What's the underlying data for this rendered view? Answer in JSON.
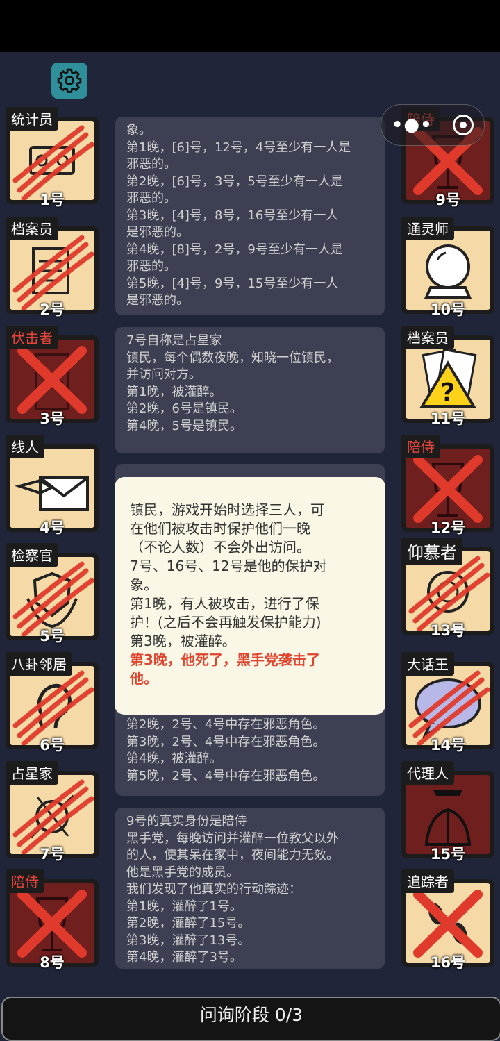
{
  "app": {
    "settings_icon": "gear-icon"
  },
  "capsule": {
    "more_icon": "more-dots-icon",
    "close_icon": "target-circle-icon"
  },
  "left_players": [
    {
      "role": "统计员",
      "number": "1号",
      "state": "scratched",
      "icon": "tally-sheet-icon"
    },
    {
      "role": "档案员",
      "number": "2号",
      "state": "scratched",
      "icon": "files-icon"
    },
    {
      "role": "伏击者",
      "number": "3号",
      "state": "dead",
      "icon": "door-icon"
    },
    {
      "role": "线人",
      "number": "4号",
      "state": "normal",
      "icon": "envelope-hand-icon"
    },
    {
      "role": "检察官",
      "number": "5号",
      "state": "scratched",
      "icon": "laurel-shield-icon"
    },
    {
      "role": "八卦邻居",
      "number": "6号",
      "state": "scratched",
      "icon": "ear-icon"
    },
    {
      "role": "占星家",
      "number": "7号",
      "state": "scratched",
      "icon": "astrolabe-icon"
    },
    {
      "role": "陪侍",
      "number": "8号",
      "state": "dead",
      "icon": "wine-glass-icon"
    }
  ],
  "right_players": [
    {
      "role": "陪侍",
      "number": "9号",
      "state": "dead",
      "icon": "wine-glass-icon"
    },
    {
      "role": "通灵师",
      "number": "10号",
      "state": "normal",
      "icon": "crystal-ball-icon"
    },
    {
      "role": "档案员",
      "number": "11号",
      "state": "normal",
      "icon": "warning-question-icon"
    },
    {
      "role": "陪侍",
      "number": "12号",
      "state": "dead",
      "icon": "wine-glass-icon"
    },
    {
      "role": "仰慕者",
      "number": "13号",
      "state": "scratched",
      "icon": "lion-emblem-icon"
    },
    {
      "role": "大话王",
      "number": "14号",
      "state": "scratched",
      "icon": "speech-bubble-icon"
    },
    {
      "role": "代理人",
      "number": "15号",
      "state": "normal-dark",
      "icon": "suited-agent-icon"
    },
    {
      "role": "追踪者",
      "number": "16号",
      "state": "dead-light",
      "icon": "footprints-icon"
    }
  ],
  "messages": [
    {
      "lines": [
        "象。",
        "第1晚，[6]号，12号，4号至少有一人是",
        "邪恶的。",
        "第2晚，[6]号，3号，5号至少有一人是",
        "邪恶的。",
        "第3晚，[4]号，8号，16号至少有一人",
        "是邪恶的。",
        "第4晚，[8]号，2号，9号至少有一人是",
        "邪恶的。",
        "第5晚，[4]号，9号，15号至少有一人",
        "是邪恶的。"
      ]
    },
    {
      "lines": [
        "7号自称是占星家",
        "镇民，每个偶数夜晚，知晓一位镇民，",
        "并访问对方。",
        "第1晚，被灌醉。",
        "第2晚，6号是镇民。",
        "第4晚，5号是镇民。"
      ]
    },
    {
      "lines": [
        "第2晚，2号、4号中存在邪恶角色。",
        "第3晚，2号、4号中存在邪恶角色。",
        "第4晚，被灌醉。",
        "第5晚，2号、4号中存在邪恶角色。"
      ]
    },
    {
      "lines": [
        "9号的真实身份是陪侍",
        "黑手党，每晚访问并灌醉一位教父以外",
        "的人，使其呆在家中，夜间能力无效。",
        "他是黑手党的成员。",
        "我们发现了他真实的行动踪迹：",
        "第1晚，灌醉了1号。",
        "第2晚，灌醉了15号。",
        "第3晚，灌醉了13号。",
        "第4晚，灌醉了3号。"
      ]
    }
  ],
  "popup": {
    "lines": [
      "镇民，游戏开始时选择三人，可",
      "在他们被攻击时保护他们一晚",
      "（不论人数）不会外出访问。",
      "7号、16号、12号是他的保护对",
      "象。",
      "第1晚，有人被攻击，进行了保",
      "护！(之后不会再触发保护能力)",
      "第3晚，被灌醉。"
    ],
    "highlight": [
      "第3晚，他死了，黑手党袭击了",
      "他。"
    ],
    "highlight_color": "#e0452f"
  },
  "bottom_bar": {
    "label": "问询阶段 0/3"
  },
  "colors": {
    "background": "#20253a",
    "card_light": "#f5d9a6",
    "card_dead": "#6e1f1e",
    "scratch": "#e03a2c",
    "label_red": "#e6453b"
  }
}
